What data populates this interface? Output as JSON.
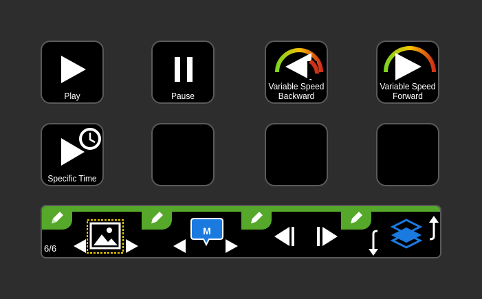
{
  "keys": [
    {
      "label": "Play",
      "icon": "play-icon"
    },
    {
      "label": "Pause",
      "icon": "pause-icon"
    },
    {
      "label_line1": "Variable Speed",
      "label_line2": "Backward",
      "icon": "speed-backward-icon"
    },
    {
      "label_line1": "Variable Speed",
      "label_line2": "Forward",
      "icon": "speed-forward-icon"
    },
    {
      "label": "Specific Time",
      "icon": "play-clock-icon"
    },
    {
      "label": ""
    },
    {
      "label": ""
    },
    {
      "label": ""
    }
  ],
  "dial_strip": {
    "page_indicator": "6/6",
    "marker_badge": "M",
    "accent_green": "#55a82a",
    "accent_blue": "#1a7ae0"
  }
}
